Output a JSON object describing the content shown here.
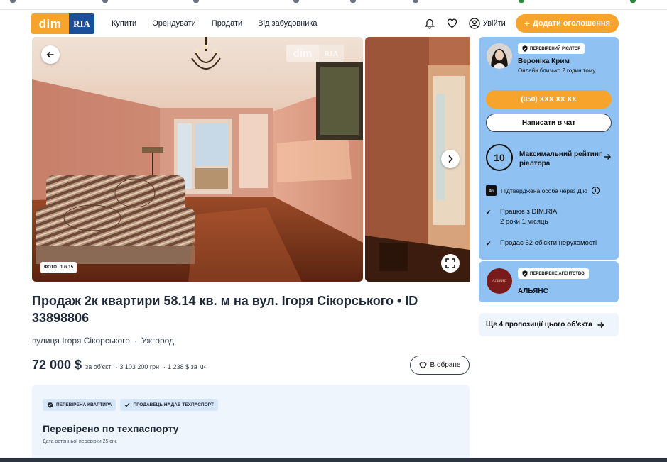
{
  "header": {
    "logo_dim": "dim",
    "logo_ria": "RIA",
    "nav": [
      "Купити",
      "Орендувати",
      "Продати",
      "Від забудовника"
    ],
    "login_label": "Увійти",
    "add_label": "Додати оголошення",
    "add_prefix": "+"
  },
  "gallery": {
    "watermark_dim": "dim",
    "watermark_ria": "RIA",
    "photo_label": "ФОТО",
    "photo_count": "1 із 15"
  },
  "listing": {
    "title": "Продаж 2к квартири 58.14 кв. м на вул. Ігоря Сікорського • ID 33898806",
    "street": "вулиця Ігоря Сікорського",
    "city": "Ужгород",
    "price": "72 000 $",
    "price_note": "за об'єкт",
    "price_uah": "3 103 200 грн",
    "price_per_m2": "1 238 $ за м²",
    "favorite_label": "В обране",
    "separator": "·"
  },
  "verification": {
    "badge_apartment": "ПЕРЕВІРЕНА КВАРТИРА",
    "badge_passport": "ПРОДАВЕЦЬ НАДАВ ТЕХПАСПОРТ",
    "title": "Перевірено по техпаспорту",
    "subtitle": "Дата останньої перевірки 25 січ."
  },
  "realtor": {
    "badge": "ПЕРЕВІРЕНИЙ РІЄЛТОР",
    "name": "Вероніка Крим",
    "online": "Онлайн близько 2 годин тому",
    "phone": "(050) XXX XX XX",
    "chat_label": "Написати в чат",
    "rating_value": "10",
    "rating_text": "Максимальний рейтинг ріелтора",
    "diia_label": "Підтверджена особа через Дію",
    "diia_logo": "Дія",
    "fact1_line1": "Працює з DIM.RIA",
    "fact1_line2": "2 роки 1 місяць",
    "fact2": "Продає 52 об'єкти нерухомості"
  },
  "agency": {
    "badge": "ПЕРЕВІРЕНЕ АГЕНТСТВО",
    "name": "АЛЬЯНС",
    "logo_text": "АЛЬЯНС"
  },
  "offers": {
    "label": "Ще 4 пропозиції цього об'єкта"
  },
  "colors": {
    "accent": "#f6a42b",
    "brand_blue": "#1a4f9b",
    "card_blue": "#8fc1f2",
    "light_panel": "#eef5fc"
  }
}
